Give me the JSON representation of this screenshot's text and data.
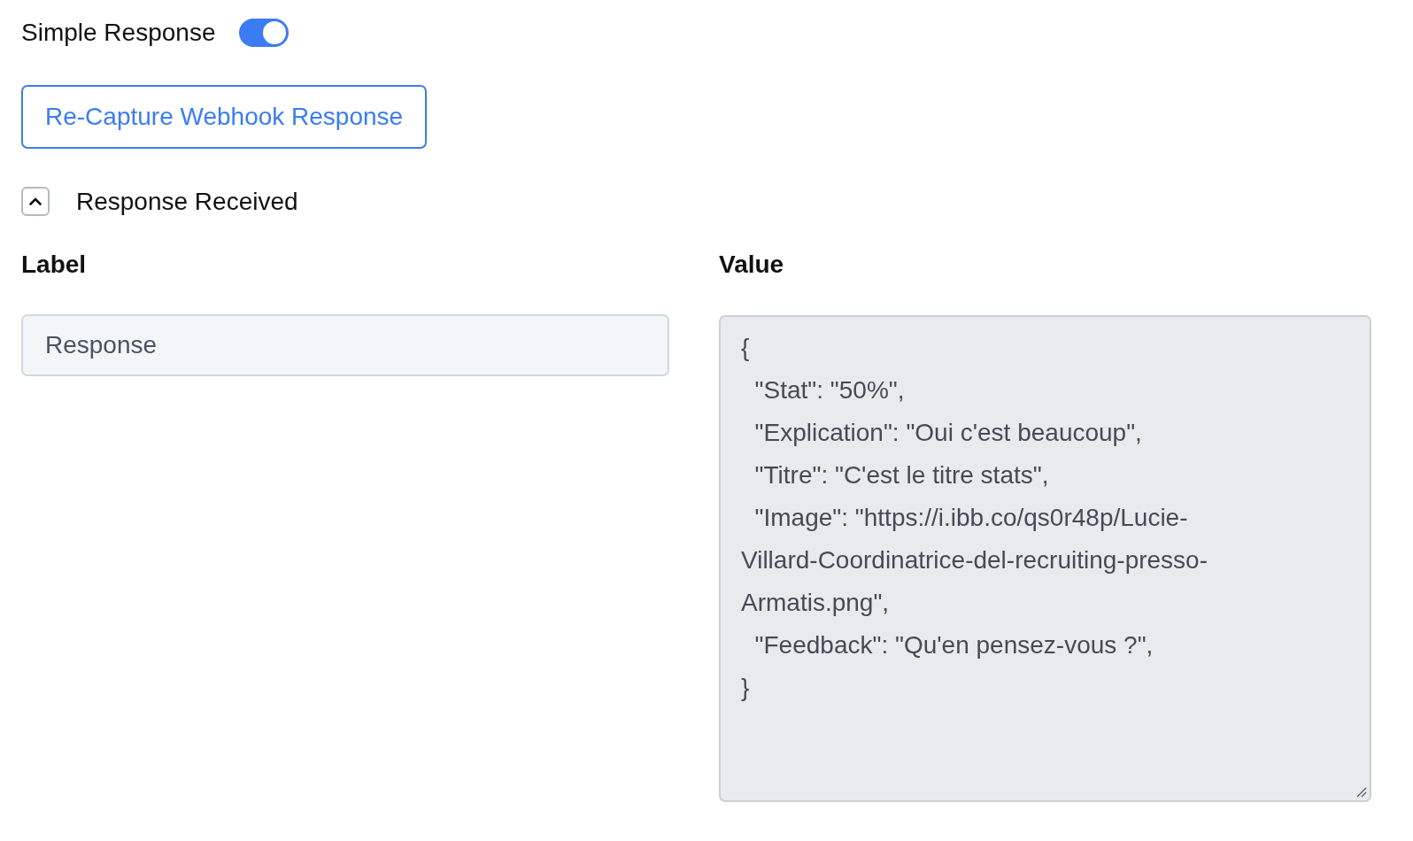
{
  "simple_response": {
    "label": "Simple Response",
    "on": true
  },
  "recapture_button": {
    "label": "Re-Capture Webhook Response"
  },
  "response_section": {
    "title": "Response Received",
    "expanded": true,
    "label_heading": "Label",
    "value_heading": "Value",
    "label_field": {
      "value": "Response"
    },
    "value_field": {
      "lines": [
        "{",
        "  \"Stat\": \"50%\",",
        "  \"Explication\": \"Oui c'est beaucoup\",",
        "  \"Titre\": \"C'est le titre stats\",",
        "  \"Image\": \"https://i.ibb.co/qs0r48p/Lucie-",
        "Villard-Coordinatrice-del-recruiting-presso-",
        "Armatis.png\",",
        "  \"Feedback\": \"Qu'en pensez-vous ?\",",
        "}"
      ]
    }
  }
}
